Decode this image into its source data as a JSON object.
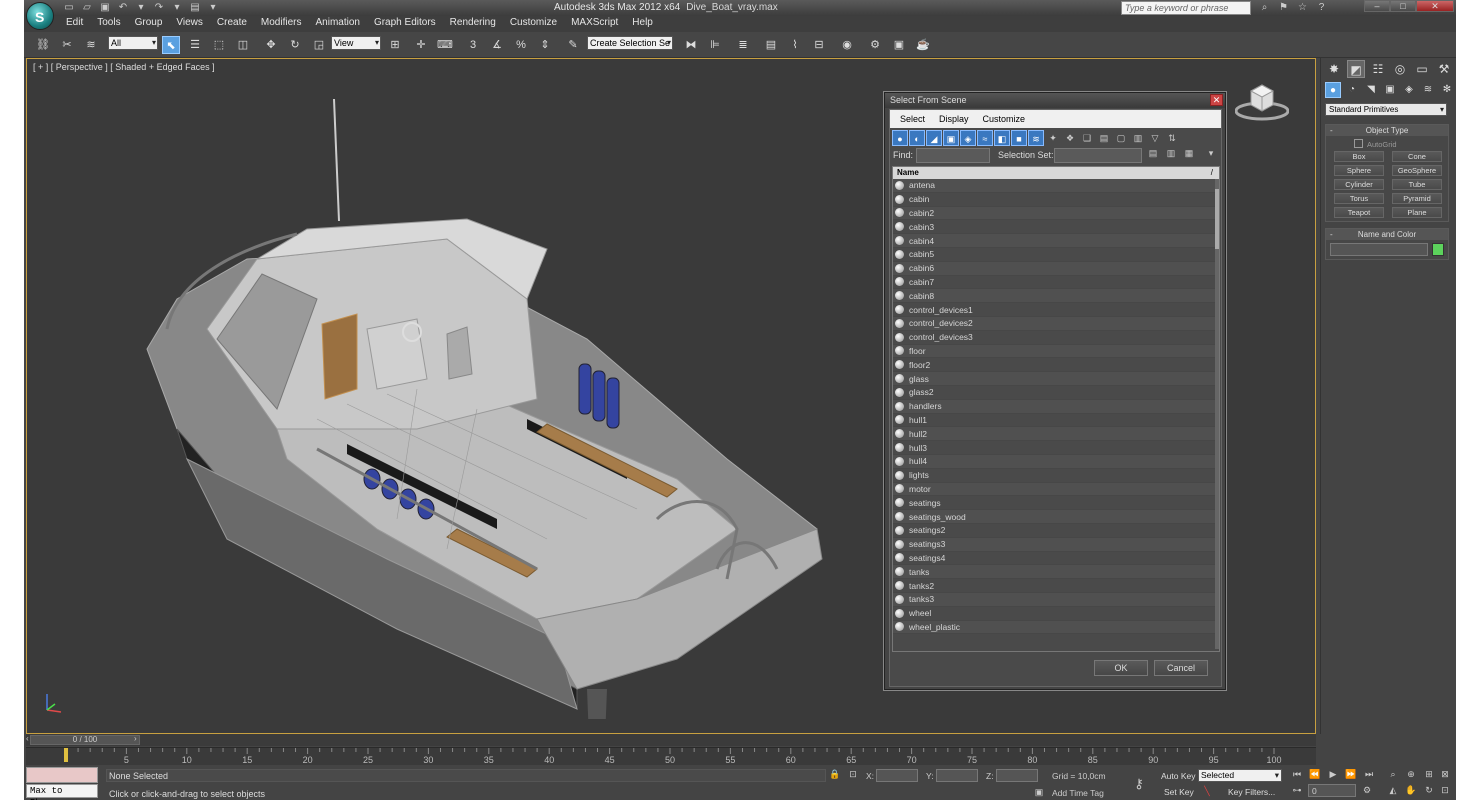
{
  "titlebar": {
    "app_title": "Autodesk 3ds Max  2012 x64",
    "file_name": "Dive_Boat_vray.max",
    "search_placeholder": "Type a keyword or phrase"
  },
  "menu": [
    "Edit",
    "Tools",
    "Group",
    "Views",
    "Create",
    "Modifiers",
    "Animation",
    "Graph Editors",
    "Rendering",
    "Customize",
    "MAXScript",
    "Help"
  ],
  "toolbar": {
    "filter_value": "All",
    "refcoord_value": "View",
    "selection_set_placeholder": "Create Selection Se"
  },
  "viewport": {
    "label": "[ + ] [ Perspective ] [ Shaded + Edged Faces ]"
  },
  "dialog": {
    "title": "Select From Scene",
    "menu": [
      "Select",
      "Display",
      "Customize"
    ],
    "find_label": "Find:",
    "selection_set_label": "Selection Set:",
    "column_name": "Name",
    "objects": [
      "antena",
      "cabin",
      "cabin2",
      "cabin3",
      "cabin4",
      "cabin5",
      "cabin6",
      "cabin7",
      "cabin8",
      "control_devices1",
      "control_devices2",
      "control_devices3",
      "floor",
      "floor2",
      "glass",
      "glass2",
      "handlers",
      "hull1",
      "hull2",
      "hull3",
      "hull4",
      "lights",
      "motor",
      "seatings",
      "seatings_wood",
      "seatings2",
      "seatings3",
      "seatings4",
      "tanks",
      "tanks2",
      "tanks3",
      "wheel",
      "wheel_plastic"
    ],
    "ok_label": "OK",
    "cancel_label": "Cancel"
  },
  "command_panel": {
    "category": "Standard Primitives",
    "object_type_title": "Object Type",
    "autogrid_label": "AutoGrid",
    "primitives": [
      "Box",
      "Cone",
      "Sphere",
      "GeoSphere",
      "Cylinder",
      "Tube",
      "Torus",
      "Pyramid",
      "Teapot",
      "Plane"
    ],
    "name_color_title": "Name and Color",
    "object_color": "#5cd25c"
  },
  "timeline": {
    "frame_display": "0 / 100",
    "ticks": [
      "0",
      "5",
      "10",
      "15",
      "20",
      "25",
      "30",
      "35",
      "40",
      "45",
      "50",
      "55",
      "60",
      "65",
      "70",
      "75",
      "80",
      "85",
      "90",
      "95",
      "100"
    ]
  },
  "status": {
    "maxscript_text": "Max to Physc.",
    "selection_status": "None Selected",
    "prompt": "Click or click-and-drag to select objects",
    "x_label": "X:",
    "y_label": "Y:",
    "z_label": "Z:",
    "grid": "Grid = 10,0cm",
    "add_time_tag": "Add Time Tag",
    "auto_key": "Auto Key",
    "set_key": "Set Key",
    "key_mode_value": "Selected",
    "key_filters": "Key Filters...",
    "current_frame": "0"
  },
  "colors": {
    "viewport_border": "#c8a040",
    "accent_blue": "#5aa0e0"
  }
}
